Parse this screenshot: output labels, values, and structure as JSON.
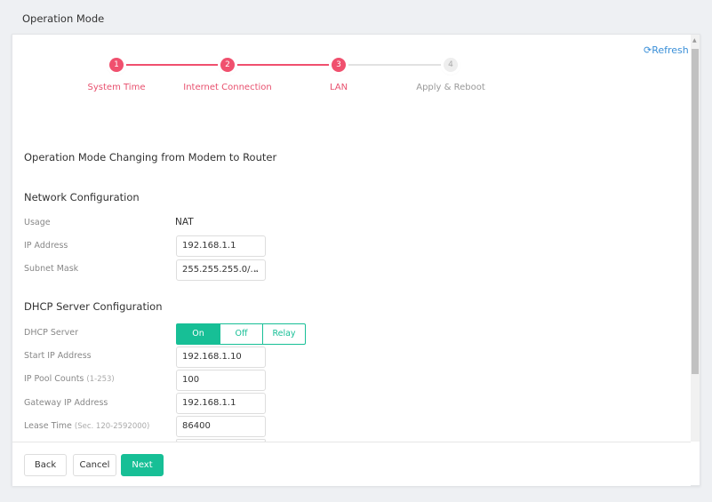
{
  "page": {
    "title": "Operation Mode",
    "refresh": "Refresh"
  },
  "steps": [
    {
      "num": "1",
      "label": "System Time",
      "state": "done"
    },
    {
      "num": "2",
      "label": "Internet Connection",
      "state": "done"
    },
    {
      "num": "3",
      "label": "LAN",
      "state": "active"
    },
    {
      "num": "4",
      "label": "Apply & Reboot",
      "state": "pending"
    }
  ],
  "heading": "Operation Mode Changing from Modem to Router",
  "network": {
    "title": "Network Configuration",
    "usage_label": "Usage",
    "usage": "NAT",
    "ip_label": "IP Address",
    "ip": "192.168.1.1",
    "mask_label": "Subnet Mask",
    "mask": "255.255.255.0/..."
  },
  "dhcp": {
    "title": "DHCP Server Configuration",
    "server_label": "DHCP Server",
    "options": [
      "On",
      "Off",
      "Relay"
    ],
    "selected": "On",
    "start_label": "Start IP Address",
    "start": "192.168.1.10",
    "pool_label": "IP Pool Counts",
    "pool_hint": "(1-253)",
    "pool": "100",
    "gw_label": "Gateway IP Address",
    "gw": "192.168.1.1",
    "lease_label": "Lease Time",
    "lease_hint": "(Sec. 120-2592000)",
    "lease": "86400"
  },
  "buttons": {
    "back": "Back",
    "cancel": "Cancel",
    "next": "Next"
  },
  "colors": {
    "accent": "#17bf96",
    "step": "#f0506e",
    "link": "#3a8fd8"
  }
}
